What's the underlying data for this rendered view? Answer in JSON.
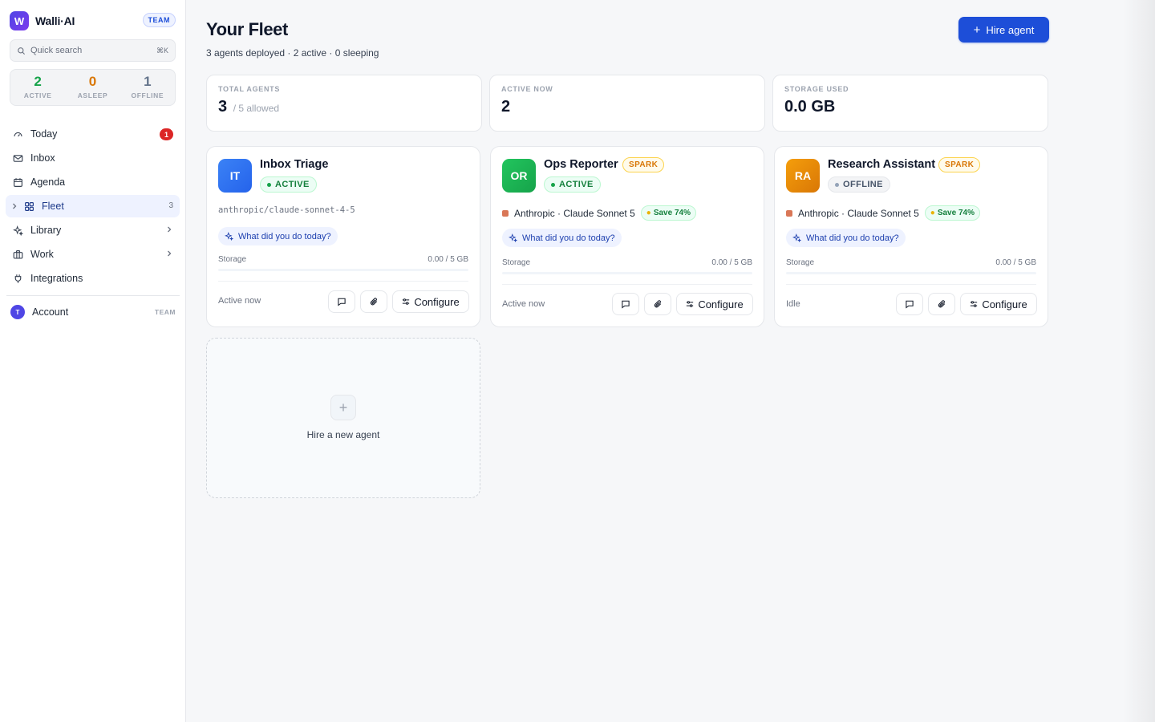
{
  "brand": {
    "logo_letter": "W",
    "name": "Walli·AI",
    "plan": "TEAM"
  },
  "search": {
    "placeholder": "Quick search",
    "shortcut": "⌘K"
  },
  "stats": [
    {
      "value": "2",
      "label": "ACTIVE",
      "color": "#16a34a"
    },
    {
      "value": "0",
      "label": "ASLEEP",
      "color": "#d97706"
    },
    {
      "value": "1",
      "label": "OFFLINE",
      "color": "#64748b"
    }
  ],
  "nav": {
    "today": {
      "label": "Today",
      "badge": "1",
      "icon": "gauge-icon"
    },
    "inbox": {
      "label": "Inbox",
      "icon": "mail-icon"
    },
    "agenda": {
      "label": "Agenda",
      "icon": "calendar-icon"
    },
    "fleet": {
      "label": "Fleet",
      "count": "3",
      "icon": "grid-icon"
    },
    "library": {
      "label": "Library",
      "icon": "sparkle-icon"
    },
    "work": {
      "label": "Work",
      "icon": "briefcase-icon"
    },
    "integrations": {
      "label": "Integrations",
      "icon": "plug-icon"
    }
  },
  "account": {
    "initial": "T",
    "label": "Account",
    "plan": "TEAM"
  },
  "header": {
    "title": "Your Fleet",
    "subtitle": "3 agents deployed · 2 active · 0 sleeping",
    "hire_label": "Hire agent"
  },
  "summary": {
    "total": {
      "label": "TOTAL AGENTS",
      "value": "3",
      "sub": "/ 5 allowed"
    },
    "active": {
      "label": "ACTIVE NOW",
      "value": "2"
    },
    "storage": {
      "label": "STORAGE USED",
      "value": "0.0 GB"
    }
  },
  "agents": [
    {
      "initials": "IT",
      "name": "Inbox Triage",
      "status": "ACTIVE",
      "color": "#2563eb",
      "model": "anthropic/claude-sonnet-4-5",
      "prompt": "What did you do today?",
      "storage_label": "Storage",
      "storage_value": "0.00 / 5 GB",
      "storage_fraction": 0,
      "footer": "Active now",
      "configure": "Configure"
    },
    {
      "initials": "OR",
      "name": "Ops Reporter",
      "tag": "SPARK",
      "status": "ACTIVE",
      "color": "#16a34a",
      "model": "Anthropic · Claude Sonnet 5",
      "save": "Save 74%",
      "prompt": "What did you do today?",
      "storage_label": "Storage",
      "storage_value": "0.00 / 5 GB",
      "storage_fraction": 0,
      "footer": "Active now",
      "configure": "Configure"
    },
    {
      "initials": "RA",
      "name": "Research Assistant",
      "tag": "SPARK",
      "status": "OFFLINE",
      "color": "#d97706",
      "model": "Anthropic · Claude Sonnet 5",
      "save": "Save 74%",
      "prompt": "What did you do today?",
      "storage_label": "Storage",
      "storage_value": "0.00 / 5 GB",
      "storage_fraction": 0,
      "footer": "Idle",
      "configure": "Configure"
    }
  ],
  "new_agent": {
    "label": "Hire a new agent"
  }
}
